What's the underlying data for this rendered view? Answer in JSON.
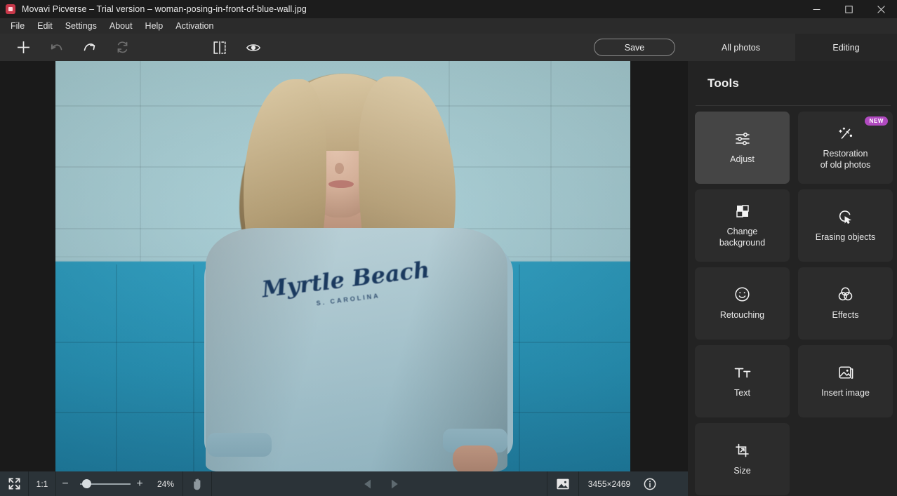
{
  "window": {
    "app_name": "Movavi Picverse",
    "title": "Movavi Picverse – Trial version – woman-posing-in-front-of-blue-wall.jpg",
    "app_icon": "app-logo-icon",
    "controls": {
      "minimize": "minimize-icon",
      "maximize": "maximize-icon",
      "close": "close-icon"
    }
  },
  "menubar": {
    "items": [
      {
        "label": "File"
      },
      {
        "label": "Edit"
      },
      {
        "label": "Settings"
      },
      {
        "label": "About"
      },
      {
        "label": "Help"
      },
      {
        "label": "Activation"
      }
    ]
  },
  "toolbar": {
    "icons": [
      {
        "name": "add-icon",
        "enabled": true
      },
      {
        "name": "undo-icon",
        "enabled": false
      },
      {
        "name": "redo-icon",
        "enabled": true
      },
      {
        "name": "reset-icon",
        "enabled": false
      },
      {
        "name": "compare-split-icon",
        "enabled": true
      },
      {
        "name": "preview-eye-icon",
        "enabled": true
      }
    ],
    "save_label": "Save",
    "tabs": [
      {
        "label": "All photos",
        "selected": false
      },
      {
        "label": "Editing",
        "selected": true
      }
    ]
  },
  "panel": {
    "title": "Tools",
    "tools": [
      {
        "label": "Adjust",
        "icon": "sliders-icon",
        "selected": true,
        "badge": ""
      },
      {
        "label": "Restoration\nof old photos",
        "label_line1": "Restoration",
        "label_line2": "of old photos",
        "icon": "magic-wand-icon",
        "selected": false,
        "badge": "NEW"
      },
      {
        "label": "Change background",
        "label_line1": "Change",
        "label_line2": "background",
        "icon": "checkerboard-icon",
        "selected": false,
        "badge": ""
      },
      {
        "label": "Erasing objects",
        "label_line1": "Erasing objects",
        "label_line2": "",
        "icon": "eraser-cursor-icon",
        "selected": false,
        "badge": ""
      },
      {
        "label": "Retouching",
        "label_line1": "Retouching",
        "label_line2": "",
        "icon": "smiley-face-icon",
        "selected": false,
        "badge": ""
      },
      {
        "label": "Effects",
        "label_line1": "Effects",
        "label_line2": "",
        "icon": "overlapping-circles-icon",
        "selected": false,
        "badge": ""
      },
      {
        "label": "Text",
        "label_line1": "Text",
        "label_line2": "",
        "icon": "text-tool-icon",
        "selected": false,
        "badge": ""
      },
      {
        "label": "Insert image",
        "label_line1": "Insert image",
        "label_line2": "",
        "icon": "insert-image-icon",
        "selected": false,
        "badge": ""
      },
      {
        "label": "Size",
        "label_line1": "Size",
        "label_line2": "",
        "icon": "crop-resize-icon",
        "selected": false,
        "badge": ""
      }
    ]
  },
  "statusbar": {
    "fullscreen_icon": "fit-to-screen-icon",
    "actual_size_label": "1:1",
    "zoom_out_label": "−",
    "zoom_in_label": "+",
    "zoom_level": "24%",
    "zoom_slider_position_pct": 18,
    "hand_tool_icon": "hand-pan-icon",
    "prev_icon": "previous-image-icon",
    "next_icon": "next-image-icon",
    "thumbnail_icon": "image-thumbnail-icon",
    "image_dimensions": "3455×2469",
    "info_icon": "info-icon"
  },
  "photo": {
    "shirt_text": "Myrtle Beach",
    "shirt_subtext": "S. CAROLINA",
    "wall_top_color": "#b3dce2",
    "wall_bottom_color": "#27a4cb",
    "shirt_color": "#b7d3da",
    "hair_color": "#c6ad82"
  },
  "colors": {
    "titlebar_bg": "#1c1c1c",
    "menubar_bg": "#2b2b2b",
    "toolbar_bg": "#2e2e2e",
    "canvas_bg": "#1a1a1a",
    "panel_bg": "#232323",
    "tile_bg": "#2c2c2c",
    "tile_active_bg": "#454545",
    "statusbar_bg": "#2b3338",
    "accent_new_badge": "#b14ac0",
    "app_icon": "#c9384a"
  }
}
